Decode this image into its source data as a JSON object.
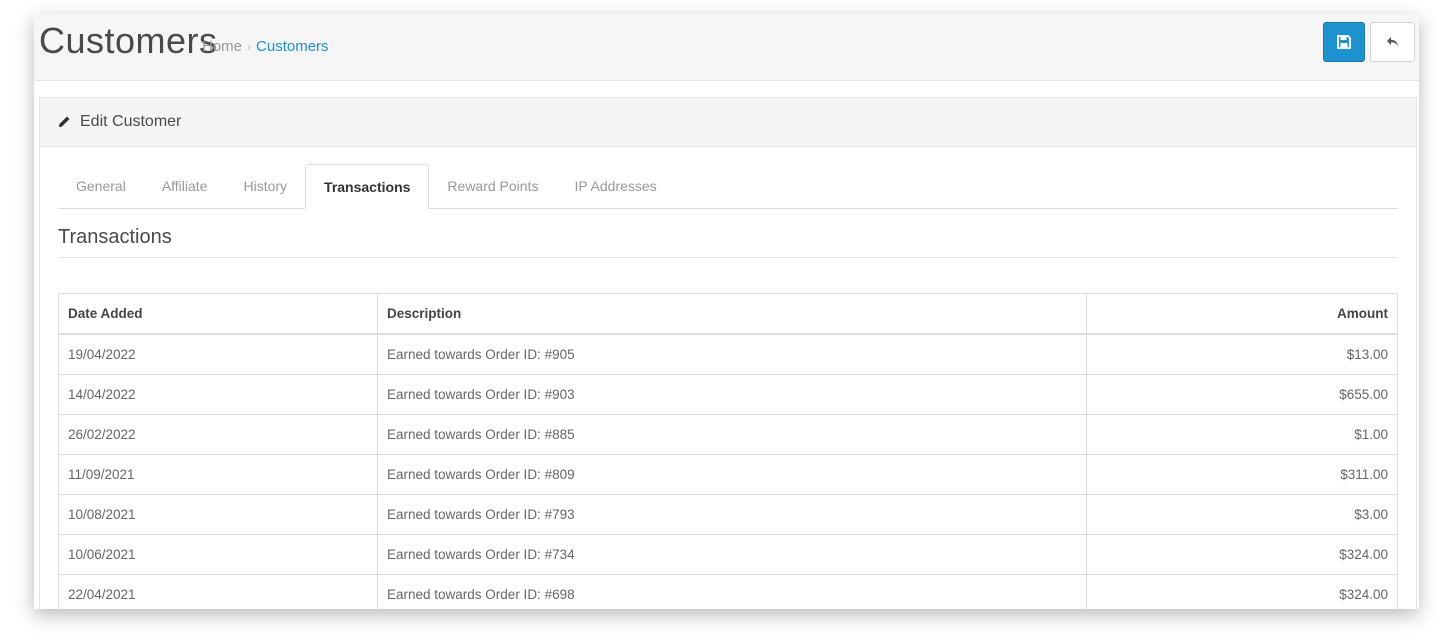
{
  "header": {
    "title": "Customers",
    "breadcrumb": {
      "home": "Home",
      "separator": "›",
      "current": "Customers"
    }
  },
  "actions": {
    "save_icon": "save-icon",
    "back_icon": "reply-icon"
  },
  "panel": {
    "heading": "Edit Customer",
    "heading_icon": "pencil-icon"
  },
  "tabs": [
    {
      "label": "General"
    },
    {
      "label": "Affiliate"
    },
    {
      "label": "History"
    },
    {
      "label": "Transactions",
      "active": true
    },
    {
      "label": "Reward Points"
    },
    {
      "label": "IP Addresses"
    }
  ],
  "section": {
    "title": "Transactions"
  },
  "table": {
    "headers": {
      "date": "Date Added",
      "description": "Description",
      "amount": "Amount"
    },
    "rows": [
      {
        "date": "19/04/2022",
        "description": "Earned towards Order ID: #905",
        "amount": "$13.00"
      },
      {
        "date": "14/04/2022",
        "description": "Earned towards Order ID: #903",
        "amount": "$655.00"
      },
      {
        "date": "26/02/2022",
        "description": "Earned towards Order ID: #885",
        "amount": "$1.00"
      },
      {
        "date": "11/09/2021",
        "description": "Earned towards Order ID: #809",
        "amount": "$311.00"
      },
      {
        "date": "10/08/2021",
        "description": "Earned towards Order ID: #793",
        "amount": "$3.00"
      },
      {
        "date": "10/06/2021",
        "description": "Earned towards Order ID: #734",
        "amount": "$324.00"
      },
      {
        "date": "22/04/2021",
        "description": "Earned towards Order ID: #698",
        "amount": "$324.00"
      }
    ]
  },
  "colors": {
    "accent": "#1e91cf",
    "header_bg": "#f6f6f6"
  }
}
